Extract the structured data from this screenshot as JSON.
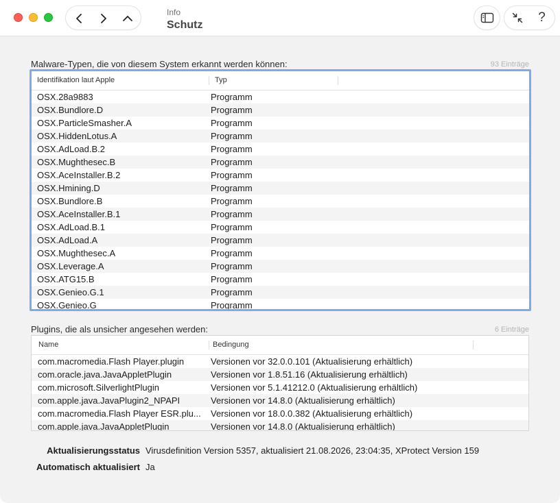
{
  "window": {
    "header_small": "Info",
    "header_title": "Schutz"
  },
  "icons": {
    "back": "chevron-left-icon",
    "forward": "chevron-right-icon",
    "up": "chevron-up-icon",
    "sidebar": "sidebar-icon",
    "collapse": "collapse-arrows-icon",
    "help": "?"
  },
  "colors": {
    "focus_ring": "#7fa9ef",
    "close": "#fe5f57",
    "minimize": "#febc2e",
    "zoom": "#28c840"
  },
  "malware": {
    "label": "Malware-Typen, die von diesem System erkannt werden können:",
    "count": "93 Einträge",
    "columns": [
      "Identifikation laut Apple",
      "Typ"
    ],
    "rows": [
      [
        "OSX.28a9883",
        "Programm"
      ],
      [
        "OSX.Bundlore.D",
        "Programm"
      ],
      [
        "OSX.ParticleSmasher.A",
        "Programm"
      ],
      [
        "OSX.HiddenLotus.A",
        "Programm"
      ],
      [
        "OSX.AdLoad.B.2",
        "Programm"
      ],
      [
        "OSX.Mughthesec.B",
        "Programm"
      ],
      [
        "OSX.AceInstaller.B.2",
        "Programm"
      ],
      [
        "OSX.Hmining.D",
        "Programm"
      ],
      [
        "OSX.Bundlore.B",
        "Programm"
      ],
      [
        "OSX.AceInstaller.B.1",
        "Programm"
      ],
      [
        "OSX.AdLoad.B.1",
        "Programm"
      ],
      [
        "OSX.AdLoad.A",
        "Programm"
      ],
      [
        "OSX.Mughthesec.A",
        "Programm"
      ],
      [
        "OSX.Leverage.A",
        "Programm"
      ],
      [
        "OSX.ATG15.B",
        "Programm"
      ],
      [
        "OSX.Genieo.G.1",
        "Programm"
      ],
      [
        "OSX.Genieo.G",
        "Programm"
      ]
    ]
  },
  "plugins": {
    "label": "Plugins, die als unsicher angesehen werden:",
    "count": "6 Einträge",
    "columns": [
      "Name",
      "Bedingung"
    ],
    "rows": [
      [
        "com.macromedia.Flash Player.plugin",
        "Versionen vor 32.0.0.101 (Aktualisierung erhältlich)"
      ],
      [
        "com.oracle.java.JavaAppletPlugin",
        "Versionen vor 1.8.51.16 (Aktualisierung erhältlich)"
      ],
      [
        "com.microsoft.SilverlightPlugin",
        "Versionen vor 5.1.41212.0 (Aktualisierung erhältlich)"
      ],
      [
        "com.apple.java.JavaPlugin2_NPAPI",
        "Versionen vor 14.8.0 (Aktualisierung erhältlich)"
      ],
      [
        "com.macromedia.Flash Player ESR.plu...",
        "Versionen vor 18.0.0.382 (Aktualisierung erhältlich)"
      ],
      [
        "com.apple.java.JavaAppletPlugin",
        "Versionen vor 14.8.0 (Aktualisierung erhältlich)"
      ]
    ]
  },
  "status": {
    "update_status_label": "Aktualisierungsstatus",
    "update_status_value": "Virusdefinition Version 5357, aktualisiert 21.08.2026, 23:04:35, XProtect Version 159",
    "auto_update_label": "Automatisch aktualisiert",
    "auto_update_value": "Ja"
  }
}
